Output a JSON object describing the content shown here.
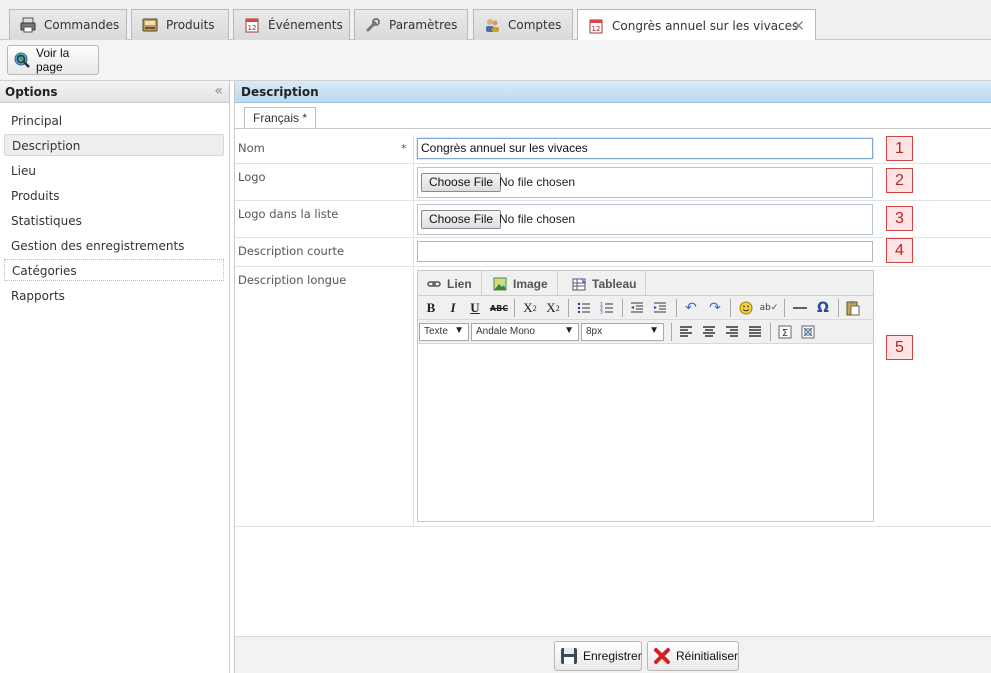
{
  "tabs": [
    {
      "label": "Commandes",
      "icon": "printer-icon"
    },
    {
      "label": "Produits",
      "icon": "register-icon"
    },
    {
      "label": "Événements",
      "icon": "calendar-icon"
    },
    {
      "label": "Paramètres",
      "icon": "wrench-icon"
    },
    {
      "label": "Comptes",
      "icon": "users-icon"
    },
    {
      "label": "Congrès annuel sur les vivaces",
      "icon": "calendar-icon",
      "active": true
    }
  ],
  "toolbar": {
    "view_page_label": "Voir la page"
  },
  "options": {
    "title": "Options",
    "collapse_glyph": "«",
    "items": [
      {
        "label": "Principal"
      },
      {
        "label": "Description",
        "selected": true
      },
      {
        "label": "Lieu"
      },
      {
        "label": "Produits"
      },
      {
        "label": "Statistiques"
      },
      {
        "label": "Gestion des enregistrements"
      },
      {
        "label": "Catégories"
      },
      {
        "label": "Rapports"
      }
    ]
  },
  "description": {
    "title": "Description",
    "language_tab": "Français *",
    "fields": {
      "name": {
        "label": "Nom",
        "required_mark": "*",
        "value": "Congrès annuel sur les vivaces",
        "marker": "1"
      },
      "logo": {
        "label": "Logo",
        "button": "Choose File",
        "status": "No file chosen",
        "marker": "2"
      },
      "list_logo": {
        "label": "Logo dans la liste",
        "button": "Choose File",
        "status": "No file chosen",
        "marker": "3"
      },
      "short_description": {
        "label": "Description courte",
        "value": "",
        "marker": "4"
      },
      "long_description": {
        "label": "Description longue",
        "marker": "5"
      }
    },
    "editor": {
      "tabs": [
        {
          "label": "Lien",
          "icon": "link-icon"
        },
        {
          "label": "Image",
          "icon": "image-icon"
        },
        {
          "label": "Tableau",
          "icon": "table-icon"
        }
      ],
      "format_select": "Texte",
      "font_select": "Andale Mono",
      "size_select": "8px"
    }
  },
  "footer": {
    "save_label": "Enregistrer",
    "reset_label": "Réinitialiser"
  },
  "colors": {
    "header_blue": "#bcd9ef",
    "marker_red": "#d04545",
    "marker_bg": "#fde5e5"
  }
}
